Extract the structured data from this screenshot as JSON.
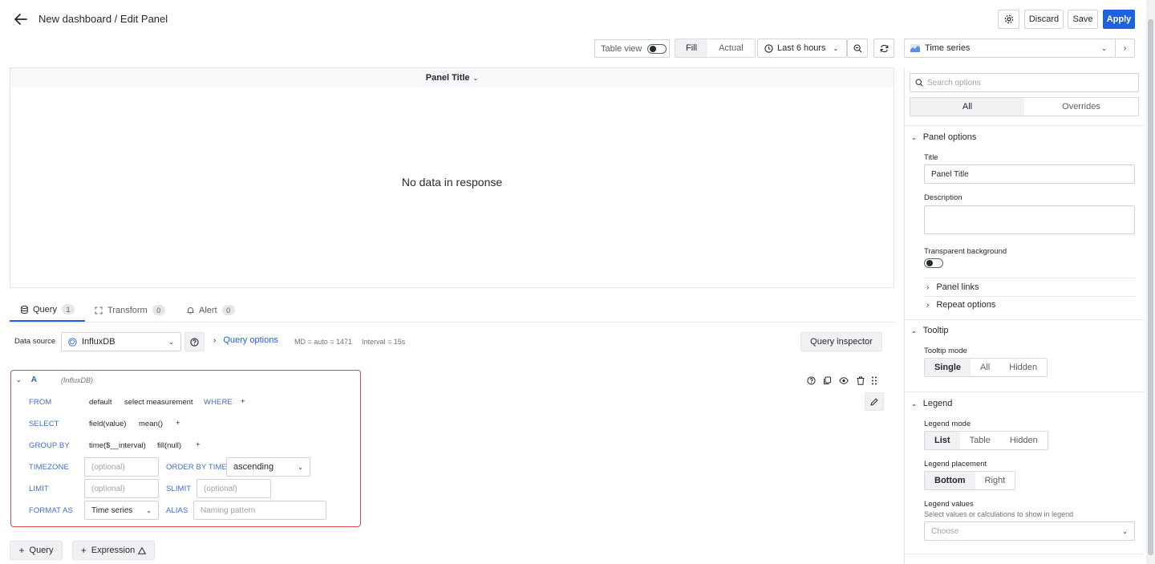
{
  "header": {
    "breadcrumb": "New dashboard / Edit Panel",
    "discard_label": "Discard",
    "save_label": "Save",
    "apply_label": "Apply"
  },
  "toolbar": {
    "table_view_label": "Table view",
    "fill_label": "Fill",
    "actual_label": "Actual",
    "time_range": "Last 6 hours",
    "visualization": "Time series"
  },
  "panel": {
    "title": "Panel Title",
    "empty_message": "No data in response"
  },
  "tabs": [
    {
      "label": "Query",
      "count": "1"
    },
    {
      "label": "Transform",
      "count": "0"
    },
    {
      "label": "Alert",
      "count": "0"
    }
  ],
  "datasource": {
    "label": "Data source",
    "value": "InfluxDB",
    "query_options_label": "Query options",
    "md": "MD = auto = 1471",
    "interval": "Interval = 15s",
    "inspector_label": "Query inspector"
  },
  "query": {
    "ref_id": "A",
    "source_tag": "(InfluxDB)",
    "from_kw": "FROM",
    "from_policy": "default",
    "from_measurement": "select measurement",
    "where_kw": "WHERE",
    "select_kw": "SELECT",
    "select_field": "field(value)",
    "select_fn": "mean()",
    "groupby_kw": "GROUP BY",
    "groupby_time": "time($__interval)",
    "groupby_fill": "fill(null)",
    "plus": "+",
    "timezone_kw": "TIMEZONE",
    "timezone_placeholder": "(optional)",
    "orderby_kw": "ORDER BY TIME",
    "orderby_value": "ascending",
    "limit_kw": "LIMIT",
    "limit_placeholder": "(optional)",
    "slimit_kw": "SLIMIT",
    "slimit_placeholder": "(optional)",
    "format_kw": "FORMAT AS",
    "format_value": "Time series",
    "alias_kw": "ALIAS",
    "alias_placeholder": "Naming pattern"
  },
  "bottom_buttons": {
    "add_query": "Query",
    "add_expression": "Expression"
  },
  "options": {
    "search_placeholder": "Search options",
    "tab_all": "All",
    "tab_overrides": "Overrides",
    "panel_options": "Panel options",
    "title_label": "Title",
    "title_value": "Panel Title",
    "description_label": "Description",
    "transparent_label": "Transparent background",
    "panel_links": "Panel links",
    "repeat_options": "Repeat options",
    "tooltip": "Tooltip",
    "tooltip_mode_label": "Tooltip mode",
    "tooltip_modes": [
      "Single",
      "All",
      "Hidden"
    ],
    "legend": "Legend",
    "legend_mode_label": "Legend mode",
    "legend_modes": [
      "List",
      "Table",
      "Hidden"
    ],
    "legend_placement_label": "Legend placement",
    "legend_placements": [
      "Bottom",
      "Right"
    ],
    "legend_values_label": "Legend values",
    "legend_values_desc": "Select values or calculations to show in legend",
    "legend_values_placeholder": "Choose"
  },
  "colors": {
    "primary": "#1f62e0",
    "query_border": "#e0474f",
    "keyword": "#3d6fd1"
  }
}
